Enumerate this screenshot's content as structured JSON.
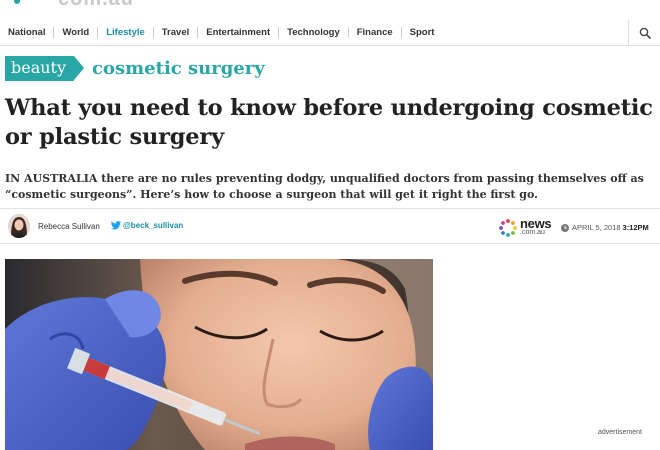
{
  "site": {
    "wordmark": "com.au"
  },
  "nav": {
    "items": [
      "National",
      "World",
      "Lifestyle",
      "Travel",
      "Entertainment",
      "Technology",
      "Finance",
      "Sport"
    ],
    "active": "Lifestyle"
  },
  "section": {
    "tag": "beauty",
    "subsection": "cosmetic surgery"
  },
  "article": {
    "headline": "What you need to know before undergoing cosmetic or plastic surgery",
    "standfirst": "IN AUSTRALIA there are no rules preventing dodgy, unqualified doctors from passing themselves off as “cosmetic surgeons”. Here’s how to choose a surgeon that will get it right the first go.",
    "author": "Rebecca Sullivan",
    "twitter_handle": "@beck_sullivan",
    "source_name": "news",
    "source_domain": ".com.au",
    "date": "APRIL 5, 2018",
    "time": "3:12PM"
  },
  "ad": {
    "label": "advertisement"
  },
  "colors": {
    "accent": "#29a7a6",
    "link": "#1a8fa8"
  }
}
